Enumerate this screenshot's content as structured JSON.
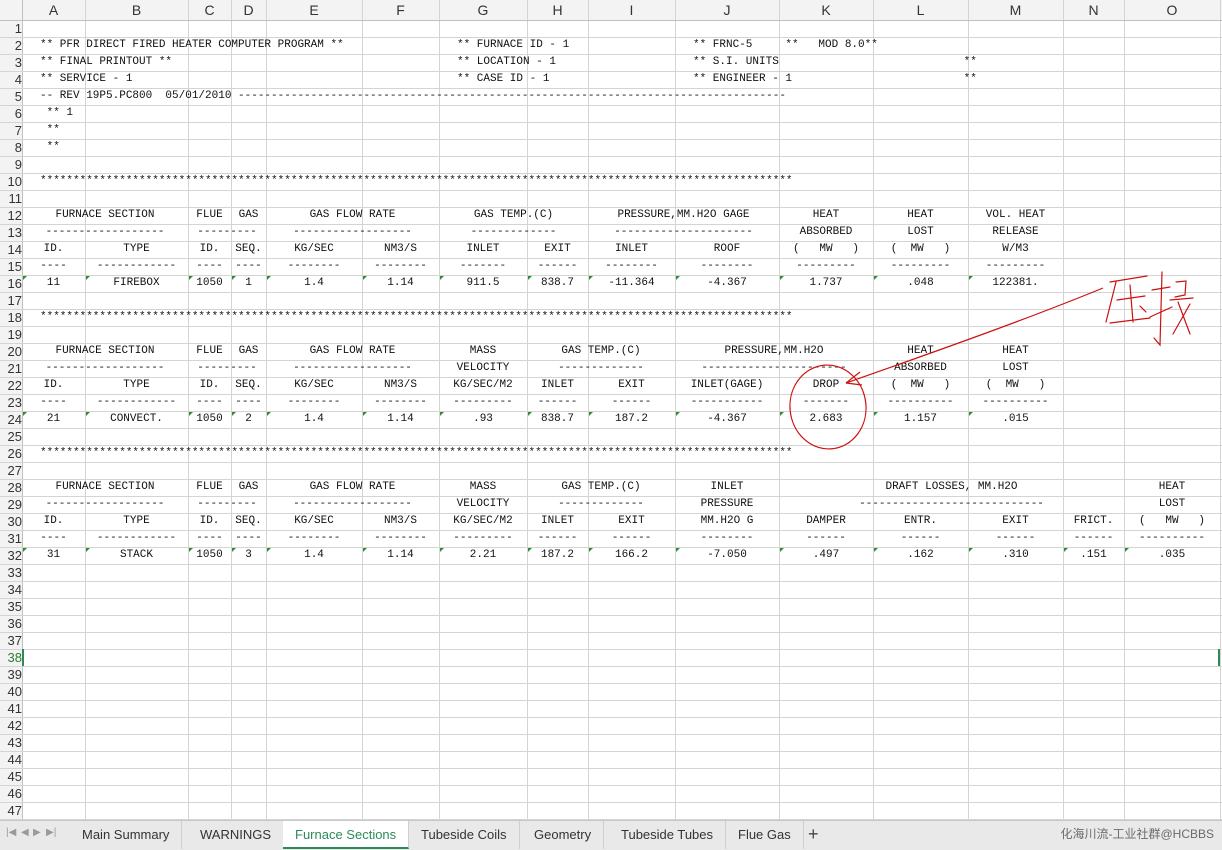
{
  "columns": [
    "A",
    "B",
    "C",
    "D",
    "E",
    "F",
    "G",
    "H",
    "I",
    "J",
    "K",
    "L",
    "M",
    "N",
    "O"
  ],
  "row_numbers": [
    "1",
    "2",
    "3",
    "4",
    "5",
    "6",
    "7",
    "8",
    "9",
    "10",
    "11",
    "12",
    "13",
    "14",
    "15",
    "16",
    "17",
    "18",
    "19",
    "20",
    "21",
    "22",
    "23",
    "24",
    "25",
    "26",
    "27",
    "28",
    "29",
    "30",
    "31",
    "32",
    "33",
    "34",
    "35",
    "36",
    "37",
    "38",
    "39",
    "40",
    "41",
    "42",
    "43",
    "44",
    "45",
    "46",
    "47"
  ],
  "active_row": "38",
  "cells": [
    {
      "r": 2,
      "c": "A",
      "a": "l",
      "t": "** PFR DIRECT FIRED HEATER COMPUTER PROGRAM **"
    },
    {
      "r": 2,
      "c": "G",
      "a": "l",
      "t": "** FURNACE ID - 1"
    },
    {
      "r": 2,
      "c": "J",
      "a": "l",
      "t": "** FRNC-5     **   MOD 8.0**"
    },
    {
      "r": 3,
      "c": "A",
      "a": "l",
      "t": "** FINAL PRINTOUT **"
    },
    {
      "r": 3,
      "c": "G",
      "a": "l",
      "t": "** LOCATION - 1"
    },
    {
      "r": 3,
      "c": "J",
      "a": "l",
      "t": "** S.I. UNITS"
    },
    {
      "r": 3,
      "c": "L",
      "a": "l",
      "t": "           **"
    },
    {
      "r": 4,
      "c": "A",
      "a": "l",
      "t": "** SERVICE - 1"
    },
    {
      "r": 4,
      "c": "G",
      "a": "l",
      "t": "** CASE ID - 1"
    },
    {
      "r": 4,
      "c": "J",
      "a": "l",
      "t": "** ENGINEER - 1"
    },
    {
      "r": 4,
      "c": "L",
      "a": "l",
      "t": "           **"
    },
    {
      "r": 5,
      "c": "A",
      "a": "l",
      "t": "-- REV 19P5.PC800  05/01/2010 -----------------------------------------------------------------------------------"
    },
    {
      "r": 6,
      "c": "A",
      "a": "l",
      "t": " ** 1"
    },
    {
      "r": 7,
      "c": "A",
      "a": "l",
      "t": " **"
    },
    {
      "r": 8,
      "c": "A",
      "a": "l",
      "t": " **"
    },
    {
      "r": 10,
      "c": "A",
      "a": "l",
      "t": "******************************************************************************************************************"
    },
    {
      "r": 12,
      "c": "AB",
      "a": "c",
      "t": "FURNACE SECTION"
    },
    {
      "r": 12,
      "c": "C",
      "a": "c",
      "t": "FLUE"
    },
    {
      "r": 12,
      "c": "D",
      "a": "c",
      "t": "GAS"
    },
    {
      "r": 12,
      "c": "EF",
      "a": "c",
      "t": "GAS FLOW RATE"
    },
    {
      "r": 12,
      "c": "GH",
      "a": "c",
      "t": "GAS TEMP.(C)"
    },
    {
      "r": 12,
      "c": "IJ",
      "a": "c",
      "t": "PRESSURE,MM.H2O GAGE"
    },
    {
      "r": 12,
      "c": "K",
      "a": "c",
      "t": "HEAT"
    },
    {
      "r": 12,
      "c": "L",
      "a": "c",
      "t": "HEAT"
    },
    {
      "r": 12,
      "c": "M",
      "a": "c",
      "t": "VOL. HEAT"
    },
    {
      "r": 13,
      "c": "AB",
      "a": "c",
      "t": "------------------"
    },
    {
      "r": 13,
      "c": "CD",
      "a": "c",
      "t": "---------"
    },
    {
      "r": 13,
      "c": "EF",
      "a": "c",
      "t": "------------------"
    },
    {
      "r": 13,
      "c": "GH",
      "a": "c",
      "t": "-------------"
    },
    {
      "r": 13,
      "c": "IJ",
      "a": "c",
      "t": "---------------------"
    },
    {
      "r": 13,
      "c": "K",
      "a": "c",
      "t": "ABSORBED"
    },
    {
      "r": 13,
      "c": "L",
      "a": "c",
      "t": "LOST"
    },
    {
      "r": 13,
      "c": "M",
      "a": "c",
      "t": "RELEASE"
    },
    {
      "r": 14,
      "c": "A",
      "a": "c",
      "t": "ID."
    },
    {
      "r": 14,
      "c": "B",
      "a": "c",
      "t": "TYPE"
    },
    {
      "r": 14,
      "c": "C",
      "a": "c",
      "t": "ID."
    },
    {
      "r": 14,
      "c": "D",
      "a": "c",
      "t": "SEQ."
    },
    {
      "r": 14,
      "c": "E",
      "a": "c",
      "t": "KG/SEC"
    },
    {
      "r": 14,
      "c": "F",
      "a": "c",
      "t": "NM3/S"
    },
    {
      "r": 14,
      "c": "G",
      "a": "c",
      "t": "INLET"
    },
    {
      "r": 14,
      "c": "H",
      "a": "c",
      "t": "EXIT"
    },
    {
      "r": 14,
      "c": "I",
      "a": "c",
      "t": "INLET"
    },
    {
      "r": 14,
      "c": "J",
      "a": "c",
      "t": "ROOF"
    },
    {
      "r": 14,
      "c": "K",
      "a": "c",
      "t": "(   MW   )"
    },
    {
      "r": 14,
      "c": "L",
      "a": "c",
      "t": "(  MW   )"
    },
    {
      "r": 14,
      "c": "M",
      "a": "c",
      "t": "W/M3"
    },
    {
      "r": 15,
      "c": "A",
      "a": "c",
      "t": "----"
    },
    {
      "r": 15,
      "c": "B",
      "a": "c",
      "t": "------------"
    },
    {
      "r": 15,
      "c": "C",
      "a": "c",
      "t": "----"
    },
    {
      "r": 15,
      "c": "D",
      "a": "c",
      "t": "----"
    },
    {
      "r": 15,
      "c": "E",
      "a": "c",
      "t": "--------"
    },
    {
      "r": 15,
      "c": "F",
      "a": "c",
      "t": "--------"
    },
    {
      "r": 15,
      "c": "G",
      "a": "c",
      "t": "-------"
    },
    {
      "r": 15,
      "c": "H",
      "a": "c",
      "t": "------"
    },
    {
      "r": 15,
      "c": "I",
      "a": "c",
      "t": "--------"
    },
    {
      "r": 15,
      "c": "J",
      "a": "c",
      "t": "--------"
    },
    {
      "r": 15,
      "c": "K",
      "a": "c",
      "t": "---------"
    },
    {
      "r": 15,
      "c": "L",
      "a": "c",
      "t": "---------"
    },
    {
      "r": 15,
      "c": "M",
      "a": "c",
      "t": "---------"
    },
    {
      "r": 16,
      "c": "A",
      "a": "c",
      "t": "11"
    },
    {
      "r": 16,
      "c": "B",
      "a": "c",
      "t": "FIREBOX"
    },
    {
      "r": 16,
      "c": "C",
      "a": "c",
      "t": "1050"
    },
    {
      "r": 16,
      "c": "D",
      "a": "c",
      "t": "1"
    },
    {
      "r": 16,
      "c": "E",
      "a": "c",
      "t": "1.4"
    },
    {
      "r": 16,
      "c": "F",
      "a": "c",
      "t": "1.14"
    },
    {
      "r": 16,
      "c": "G",
      "a": "c",
      "t": "911.5"
    },
    {
      "r": 16,
      "c": "H",
      "a": "c",
      "t": "838.7"
    },
    {
      "r": 16,
      "c": "I",
      "a": "c",
      "t": "-11.364"
    },
    {
      "r": 16,
      "c": "J",
      "a": "c",
      "t": "-4.367"
    },
    {
      "r": 16,
      "c": "K",
      "a": "c",
      "t": "1.737"
    },
    {
      "r": 16,
      "c": "L",
      "a": "c",
      "t": ".048"
    },
    {
      "r": 16,
      "c": "M",
      "a": "c",
      "t": "122381."
    },
    {
      "r": 18,
      "c": "A",
      "a": "l",
      "t": "******************************************************************************************************************"
    },
    {
      "r": 20,
      "c": "AB",
      "a": "c",
      "t": "FURNACE SECTION"
    },
    {
      "r": 20,
      "c": "C",
      "a": "c",
      "t": "FLUE"
    },
    {
      "r": 20,
      "c": "D",
      "a": "c",
      "t": "GAS"
    },
    {
      "r": 20,
      "c": "EF",
      "a": "c",
      "t": "GAS FLOW RATE"
    },
    {
      "r": 20,
      "c": "G",
      "a": "c",
      "t": "MASS"
    },
    {
      "r": 20,
      "c": "HI",
      "a": "c",
      "t": "GAS TEMP.(C)"
    },
    {
      "r": 20,
      "c": "JK",
      "a": "c",
      "t": "PRESSURE,MM.H2O"
    },
    {
      "r": 20,
      "c": "L",
      "a": "c",
      "t": "HEAT"
    },
    {
      "r": 20,
      "c": "M",
      "a": "c",
      "t": "HEAT"
    },
    {
      "r": 21,
      "c": "AB",
      "a": "c",
      "t": "------------------"
    },
    {
      "r": 21,
      "c": "CD",
      "a": "c",
      "t": "---------"
    },
    {
      "r": 21,
      "c": "EF",
      "a": "c",
      "t": "------------------"
    },
    {
      "r": 21,
      "c": "G",
      "a": "c",
      "t": "VELOCITY"
    },
    {
      "r": 21,
      "c": "HI",
      "a": "c",
      "t": "-------------"
    },
    {
      "r": 21,
      "c": "JK",
      "a": "c",
      "t": "----------------------"
    },
    {
      "r": 21,
      "c": "L",
      "a": "c",
      "t": "ABSORBED"
    },
    {
      "r": 21,
      "c": "M",
      "a": "c",
      "t": "LOST"
    },
    {
      "r": 22,
      "c": "A",
      "a": "c",
      "t": "ID."
    },
    {
      "r": 22,
      "c": "B",
      "a": "c",
      "t": "TYPE"
    },
    {
      "r": 22,
      "c": "C",
      "a": "c",
      "t": "ID."
    },
    {
      "r": 22,
      "c": "D",
      "a": "c",
      "t": "SEQ."
    },
    {
      "r": 22,
      "c": "E",
      "a": "c",
      "t": "KG/SEC"
    },
    {
      "r": 22,
      "c": "F",
      "a": "c",
      "t": "NM3/S"
    },
    {
      "r": 22,
      "c": "G",
      "a": "c",
      "t": "KG/SEC/M2"
    },
    {
      "r": 22,
      "c": "H",
      "a": "c",
      "t": "INLET"
    },
    {
      "r": 22,
      "c": "I",
      "a": "c",
      "t": "EXIT"
    },
    {
      "r": 22,
      "c": "J",
      "a": "c",
      "t": "INLET(GAGE)"
    },
    {
      "r": 22,
      "c": "K",
      "a": "c",
      "t": "DROP"
    },
    {
      "r": 22,
      "c": "L",
      "a": "c",
      "t": "(  MW   )"
    },
    {
      "r": 22,
      "c": "M",
      "a": "c",
      "t": "(  MW   )"
    },
    {
      "r": 23,
      "c": "A",
      "a": "c",
      "t": "----"
    },
    {
      "r": 23,
      "c": "B",
      "a": "c",
      "t": "------------"
    },
    {
      "r": 23,
      "c": "C",
      "a": "c",
      "t": "----"
    },
    {
      "r": 23,
      "c": "D",
      "a": "c",
      "t": "----"
    },
    {
      "r": 23,
      "c": "E",
      "a": "c",
      "t": "--------"
    },
    {
      "r": 23,
      "c": "F",
      "a": "c",
      "t": "--------"
    },
    {
      "r": 23,
      "c": "G",
      "a": "c",
      "t": "---------"
    },
    {
      "r": 23,
      "c": "H",
      "a": "c",
      "t": "------"
    },
    {
      "r": 23,
      "c": "I",
      "a": "c",
      "t": "------"
    },
    {
      "r": 23,
      "c": "J",
      "a": "c",
      "t": "-----------"
    },
    {
      "r": 23,
      "c": "K",
      "a": "c",
      "t": "-------"
    },
    {
      "r": 23,
      "c": "L",
      "a": "c",
      "t": "----------"
    },
    {
      "r": 23,
      "c": "M",
      "a": "c",
      "t": "----------"
    },
    {
      "r": 24,
      "c": "A",
      "a": "c",
      "t": "21"
    },
    {
      "r": 24,
      "c": "B",
      "a": "c",
      "t": "CONVECT."
    },
    {
      "r": 24,
      "c": "C",
      "a": "c",
      "t": "1050"
    },
    {
      "r": 24,
      "c": "D",
      "a": "c",
      "t": "2"
    },
    {
      "r": 24,
      "c": "E",
      "a": "c",
      "t": "1.4"
    },
    {
      "r": 24,
      "c": "F",
      "a": "c",
      "t": "1.14"
    },
    {
      "r": 24,
      "c": "G",
      "a": "c",
      "t": ".93"
    },
    {
      "r": 24,
      "c": "H",
      "a": "c",
      "t": "838.7"
    },
    {
      "r": 24,
      "c": "I",
      "a": "c",
      "t": "187.2"
    },
    {
      "r": 24,
      "c": "J",
      "a": "c",
      "t": "-4.367"
    },
    {
      "r": 24,
      "c": "K",
      "a": "c",
      "t": "2.683"
    },
    {
      "r": 24,
      "c": "L",
      "a": "c",
      "t": "1.157"
    },
    {
      "r": 24,
      "c": "M",
      "a": "c",
      "t": ".015"
    },
    {
      "r": 26,
      "c": "A",
      "a": "l",
      "t": "******************************************************************************************************************"
    },
    {
      "r": 28,
      "c": "AB",
      "a": "c",
      "t": "FURNACE SECTION"
    },
    {
      "r": 28,
      "c": "C",
      "a": "c",
      "t": "FLUE"
    },
    {
      "r": 28,
      "c": "D",
      "a": "c",
      "t": "GAS"
    },
    {
      "r": 28,
      "c": "EF",
      "a": "c",
      "t": "GAS FLOW RATE"
    },
    {
      "r": 28,
      "c": "G",
      "a": "c",
      "t": "MASS"
    },
    {
      "r": 28,
      "c": "HI",
      "a": "c",
      "t": "GAS TEMP.(C)"
    },
    {
      "r": 28,
      "c": "J",
      "a": "c",
      "t": "INLET"
    },
    {
      "r": 28,
      "c": "KLMN",
      "a": "c",
      "t": "DRAFT LOSSES, MM.H2O"
    },
    {
      "r": 28,
      "c": "O",
      "a": "c",
      "t": "HEAT"
    },
    {
      "r": 29,
      "c": "AB",
      "a": "c",
      "t": "------------------"
    },
    {
      "r": 29,
      "c": "CD",
      "a": "c",
      "t": "---------"
    },
    {
      "r": 29,
      "c": "EF",
      "a": "c",
      "t": "------------------"
    },
    {
      "r": 29,
      "c": "G",
      "a": "c",
      "t": "VELOCITY"
    },
    {
      "r": 29,
      "c": "HI",
      "a": "c",
      "t": "-------------"
    },
    {
      "r": 29,
      "c": "J",
      "a": "c",
      "t": "PRESSURE"
    },
    {
      "r": 29,
      "c": "KLMN",
      "a": "c",
      "t": "----------------------------"
    },
    {
      "r": 29,
      "c": "O",
      "a": "c",
      "t": "LOST"
    },
    {
      "r": 30,
      "c": "A",
      "a": "c",
      "t": "ID."
    },
    {
      "r": 30,
      "c": "B",
      "a": "c",
      "t": "TYPE"
    },
    {
      "r": 30,
      "c": "C",
      "a": "c",
      "t": "ID."
    },
    {
      "r": 30,
      "c": "D",
      "a": "c",
      "t": "SEQ."
    },
    {
      "r": 30,
      "c": "E",
      "a": "c",
      "t": "KG/SEC"
    },
    {
      "r": 30,
      "c": "F",
      "a": "c",
      "t": "NM3/S"
    },
    {
      "r": 30,
      "c": "G",
      "a": "c",
      "t": "KG/SEC/M2"
    },
    {
      "r": 30,
      "c": "H",
      "a": "c",
      "t": "INLET"
    },
    {
      "r": 30,
      "c": "I",
      "a": "c",
      "t": "EXIT"
    },
    {
      "r": 30,
      "c": "J",
      "a": "c",
      "t": "MM.H2O G"
    },
    {
      "r": 30,
      "c": "K",
      "a": "c",
      "t": "DAMPER"
    },
    {
      "r": 30,
      "c": "L",
      "a": "c",
      "t": "ENTR."
    },
    {
      "r": 30,
      "c": "M",
      "a": "c",
      "t": "EXIT"
    },
    {
      "r": 30,
      "c": "N",
      "a": "c",
      "t": "FRICT."
    },
    {
      "r": 30,
      "c": "O",
      "a": "c",
      "t": "(   MW   )"
    },
    {
      "r": 31,
      "c": "A",
      "a": "c",
      "t": "----"
    },
    {
      "r": 31,
      "c": "B",
      "a": "c",
      "t": "------------"
    },
    {
      "r": 31,
      "c": "C",
      "a": "c",
      "t": "----"
    },
    {
      "r": 31,
      "c": "D",
      "a": "c",
      "t": "----"
    },
    {
      "r": 31,
      "c": "E",
      "a": "c",
      "t": "--------"
    },
    {
      "r": 31,
      "c": "F",
      "a": "c",
      "t": "--------"
    },
    {
      "r": 31,
      "c": "G",
      "a": "c",
      "t": "---------"
    },
    {
      "r": 31,
      "c": "H",
      "a": "c",
      "t": "------"
    },
    {
      "r": 31,
      "c": "I",
      "a": "c",
      "t": "------"
    },
    {
      "r": 31,
      "c": "J",
      "a": "c",
      "t": "--------"
    },
    {
      "r": 31,
      "c": "K",
      "a": "c",
      "t": "------"
    },
    {
      "r": 31,
      "c": "L",
      "a": "c",
      "t": "------"
    },
    {
      "r": 31,
      "c": "M",
      "a": "c",
      "t": "------"
    },
    {
      "r": 31,
      "c": "N",
      "a": "c",
      "t": "------"
    },
    {
      "r": 31,
      "c": "O",
      "a": "c",
      "t": "----------"
    },
    {
      "r": 32,
      "c": "A",
      "a": "c",
      "t": "31"
    },
    {
      "r": 32,
      "c": "B",
      "a": "c",
      "t": "STACK"
    },
    {
      "r": 32,
      "c": "C",
      "a": "c",
      "t": "1050"
    },
    {
      "r": 32,
      "c": "D",
      "a": "c",
      "t": "3"
    },
    {
      "r": 32,
      "c": "E",
      "a": "c",
      "t": "1.4"
    },
    {
      "r": 32,
      "c": "F",
      "a": "c",
      "t": "1.14"
    },
    {
      "r": 32,
      "c": "G",
      "a": "c",
      "t": "2.21"
    },
    {
      "r": 32,
      "c": "H",
      "a": "c",
      "t": "187.2"
    },
    {
      "r": 32,
      "c": "I",
      "a": "c",
      "t": "166.2"
    },
    {
      "r": 32,
      "c": "J",
      "a": "c",
      "t": "-7.050"
    },
    {
      "r": 32,
      "c": "K",
      "a": "c",
      "t": ".497"
    },
    {
      "r": 32,
      "c": "L",
      "a": "c",
      "t": ".162"
    },
    {
      "r": 32,
      "c": "M",
      "a": "c",
      "t": ".310"
    },
    {
      "r": 32,
      "c": "N",
      "a": "c",
      "t": ".151"
    },
    {
      "r": 32,
      "c": "O",
      "a": "c",
      "t": ".035"
    }
  ],
  "tabs": [
    {
      "label": "Main Summary",
      "active": false
    },
    {
      "label": "WARNINGS",
      "active": false
    },
    {
      "label": "Furnace Sections",
      "active": true
    },
    {
      "label": "Tubeside Coils",
      "active": false
    },
    {
      "label": "Geometry",
      "active": false
    },
    {
      "label": "Tubeside Tubes",
      "active": false
    },
    {
      "label": "Flue Gas",
      "active": false
    }
  ],
  "add_tab_label": "+",
  "watermark_text": "化海川流-工业社群@HCBBS",
  "annotation_handwriting": "压损",
  "colors": {
    "annotation": "#cc1111",
    "active_tab": "#2e8b57",
    "error_mark": "#2e8b2e",
    "grid": "#d4d4d4"
  }
}
